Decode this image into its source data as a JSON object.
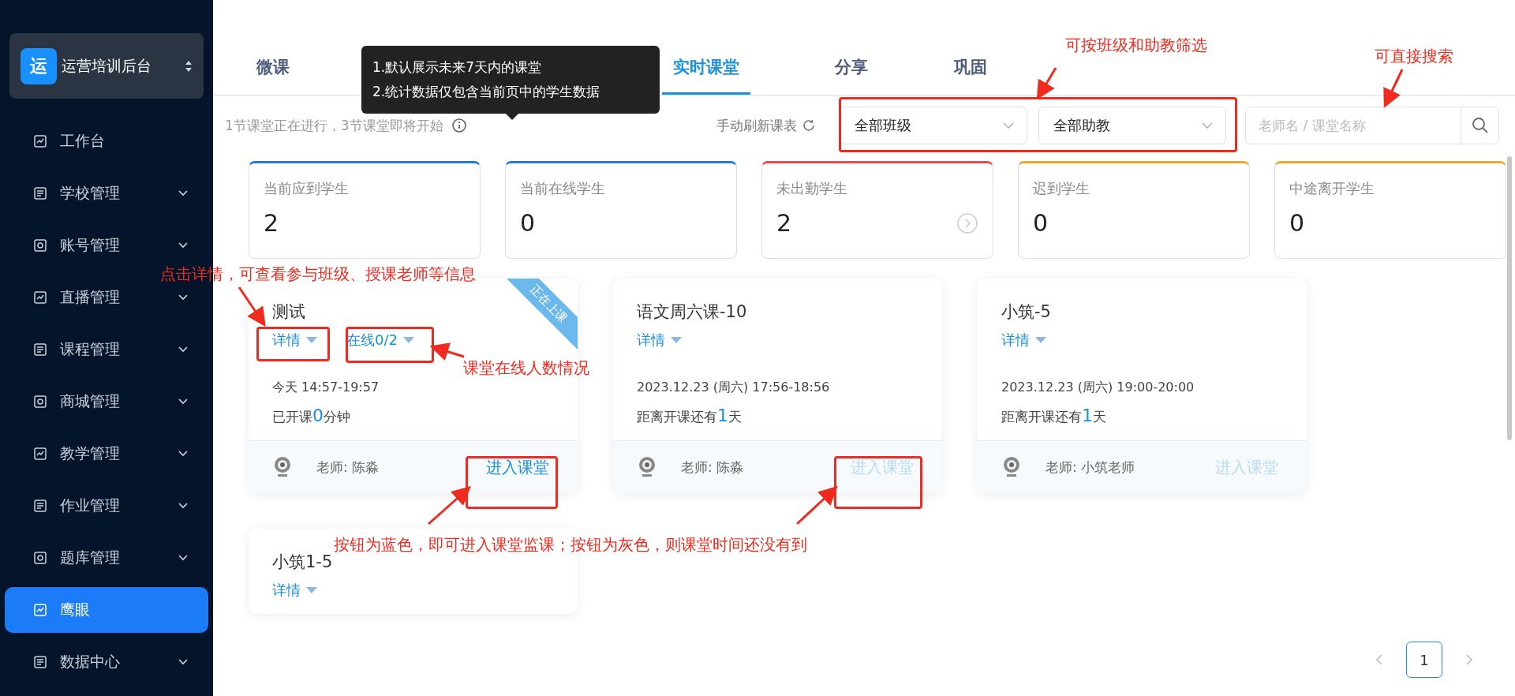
{
  "sidebar": {
    "brand": {
      "logo": "运",
      "name": "运营培训后台"
    },
    "items": [
      {
        "label": "工作台",
        "selected": false,
        "expandable": false
      },
      {
        "label": "学校管理",
        "selected": false,
        "expandable": true
      },
      {
        "label": "账号管理",
        "selected": false,
        "expandable": true
      },
      {
        "label": "直播管理",
        "selected": false,
        "expandable": true
      },
      {
        "label": "课程管理",
        "selected": false,
        "expandable": true
      },
      {
        "label": "商城管理",
        "selected": false,
        "expandable": true
      },
      {
        "label": "教学管理",
        "selected": false,
        "expandable": true
      },
      {
        "label": "作业管理",
        "selected": false,
        "expandable": true
      },
      {
        "label": "题库管理",
        "selected": false,
        "expandable": true
      },
      {
        "label": "鹰眼",
        "selected": true,
        "expandable": false
      },
      {
        "label": "数据中心",
        "selected": false,
        "expandable": true
      }
    ]
  },
  "tabs": [
    {
      "label": "微课",
      "selected": false
    },
    {
      "label": "实时课堂",
      "selected": true
    },
    {
      "label": "分享",
      "selected": false
    },
    {
      "label": "巩固",
      "selected": false
    }
  ],
  "tooltip": {
    "lines": [
      "1.默认展示未来7天内的课堂",
      "2.统计数据仅包含当前页中的学生数据"
    ]
  },
  "summary": "1节课堂正在进行，3节课堂即将开始",
  "refresh": "手动刷新课表",
  "filters": [
    {
      "value": "全部班级"
    },
    {
      "value": "全部助教"
    }
  ],
  "search": {
    "placeholder": "老师名 / 课堂名称"
  },
  "stats": [
    {
      "label": "当前应到学生",
      "value": "2",
      "color": "#1a7ee6",
      "has_link": false
    },
    {
      "label": "当前在线学生",
      "value": "0",
      "color": "#1a7ee6",
      "has_link": false
    },
    {
      "label": "未出勤学生",
      "value": "2",
      "color": "#f04848",
      "has_link": true
    },
    {
      "label": "迟到学生",
      "value": "0",
      "color": "#f5a623",
      "has_link": false
    },
    {
      "label": "中途离开学生",
      "value": "0",
      "color": "#f5a623",
      "has_link": false
    }
  ],
  "classes": [
    {
      "title": "测试",
      "detail": "详情",
      "online": "在线0/2",
      "badge": "正在上课",
      "time": "今天 14:57-19:57",
      "status_prefix": "已开课",
      "status_number": "0",
      "status_suffix": "分钟",
      "teacher": "老师: 陈淼",
      "enter": {
        "label": "进入课堂",
        "disabled": false
      }
    },
    {
      "title": "语文周六课-10",
      "detail": "详情",
      "time": "2023.12.23 (周六) 17:56-18:56",
      "status_prefix": "距离开课还有",
      "status_number": "1",
      "status_suffix": "天",
      "teacher": "老师: 陈淼",
      "enter": {
        "label": "进入课堂",
        "disabled": true
      }
    },
    {
      "title": "小筑-5",
      "detail": "详情",
      "time": "2023.12.23 (周六) 19:00-20:00",
      "status_prefix": "距离开课还有",
      "status_number": "1",
      "status_suffix": "天",
      "teacher": "老师: 小筑老师",
      "enter": {
        "label": "进入课堂",
        "disabled": true
      }
    },
    {
      "title": "小筑1-5",
      "detail": "详情"
    }
  ],
  "pagination": {
    "pages": [
      {
        "label": "1",
        "selected": true
      }
    ]
  },
  "annotations": [
    "可按班级和助教筛选",
    "可直接搜索",
    "点击详情，可查看参与班级、授课老师等信息",
    "课堂在线人数情况",
    "按钮为蓝色，即可进入课堂监课；按钮为灰色，则课堂时间还没有到"
  ]
}
